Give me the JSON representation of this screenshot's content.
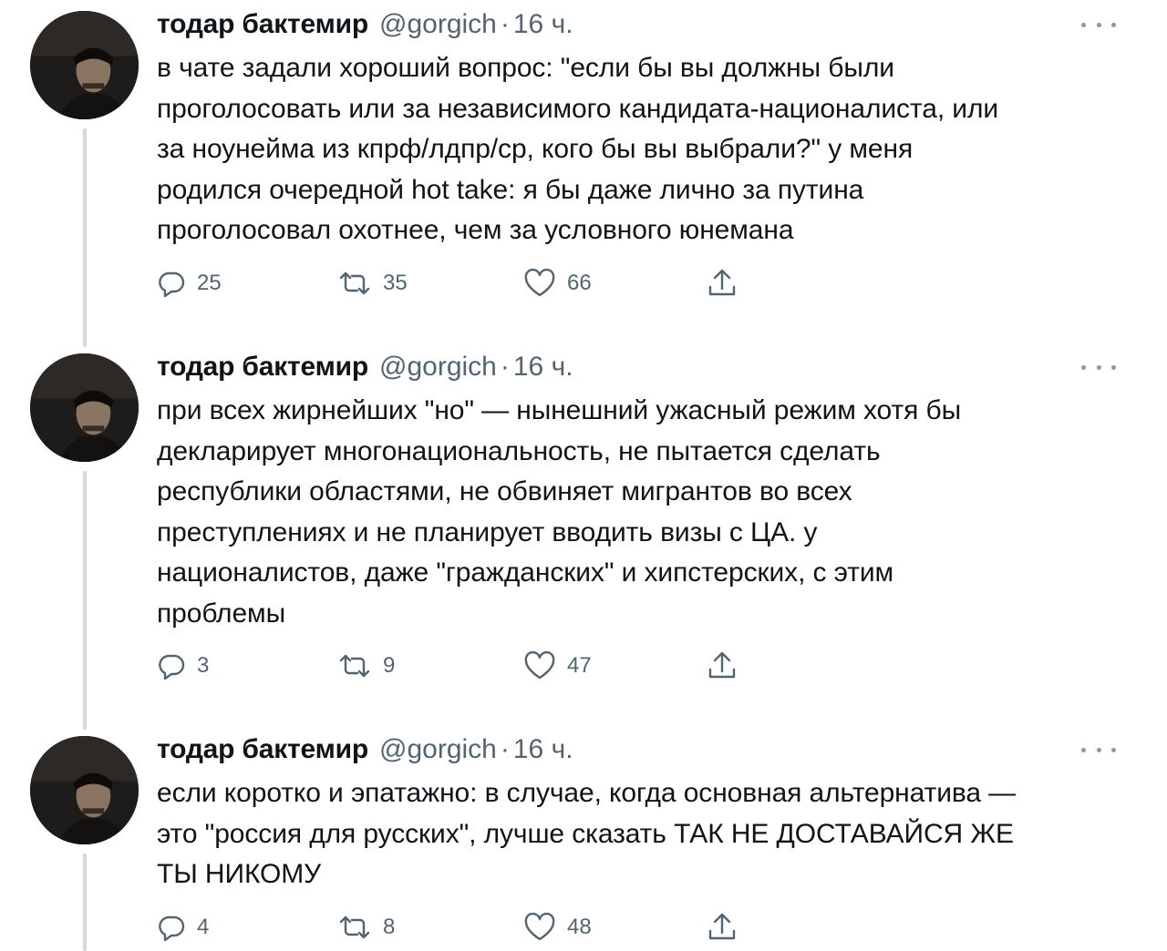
{
  "tweets": [
    {
      "author_name": "тодар бактемир",
      "handle": "@gorgich",
      "separator": "·",
      "time": "16 ч.",
      "text_lines": [
        "в чате задали хороший вопрос: \"если бы вы должны были",
        "проголосовать или за независимого кандидата-националиста, или",
        "за ноунейма из кпрф/лдпр/ср, кого бы вы выбрали?\" у меня",
        "родился очередной hot take: я бы даже лично за путина",
        "проголосовал охотнее, чем за условного юнемана"
      ],
      "replies": "25",
      "retweets": "35",
      "likes": "66"
    },
    {
      "author_name": "тодар бактемир",
      "handle": "@gorgich",
      "separator": "·",
      "time": "16 ч.",
      "text_lines": [
        "при всех жирнейших \"но\" — нынешний ужасный режим хотя бы",
        "декларирует многонациональность, не пытается сделать",
        "республики областями, не обвиняет мигрантов во всех",
        "преступлениях и не планирует вводить визы с ЦА. у",
        "националистов, даже \"гражданских\" и хипстерских, с этим",
        "проблемы"
      ],
      "replies": "3",
      "retweets": "9",
      "likes": "47"
    },
    {
      "author_name": "тодар бактемир",
      "handle": "@gorgich",
      "separator": "·",
      "time": "16 ч.",
      "text_lines": [
        "если коротко и эпатажно: в случае, когда основная альтернатива —",
        "это \"россия для русских\", лучше сказать ТАК НЕ ДОСТАВАЙСЯ ЖЕ",
        "ТЫ НИКОМУ"
      ],
      "replies": "4",
      "retweets": "8",
      "likes": "48"
    }
  ],
  "icons": {
    "reply": "reply-icon",
    "retweet": "retweet-icon",
    "like": "heart-icon",
    "share": "share-icon",
    "more": "more-icon"
  },
  "colors": {
    "text": "#0f1419",
    "secondary": "#536471",
    "thread_line": "#cfd9de"
  }
}
